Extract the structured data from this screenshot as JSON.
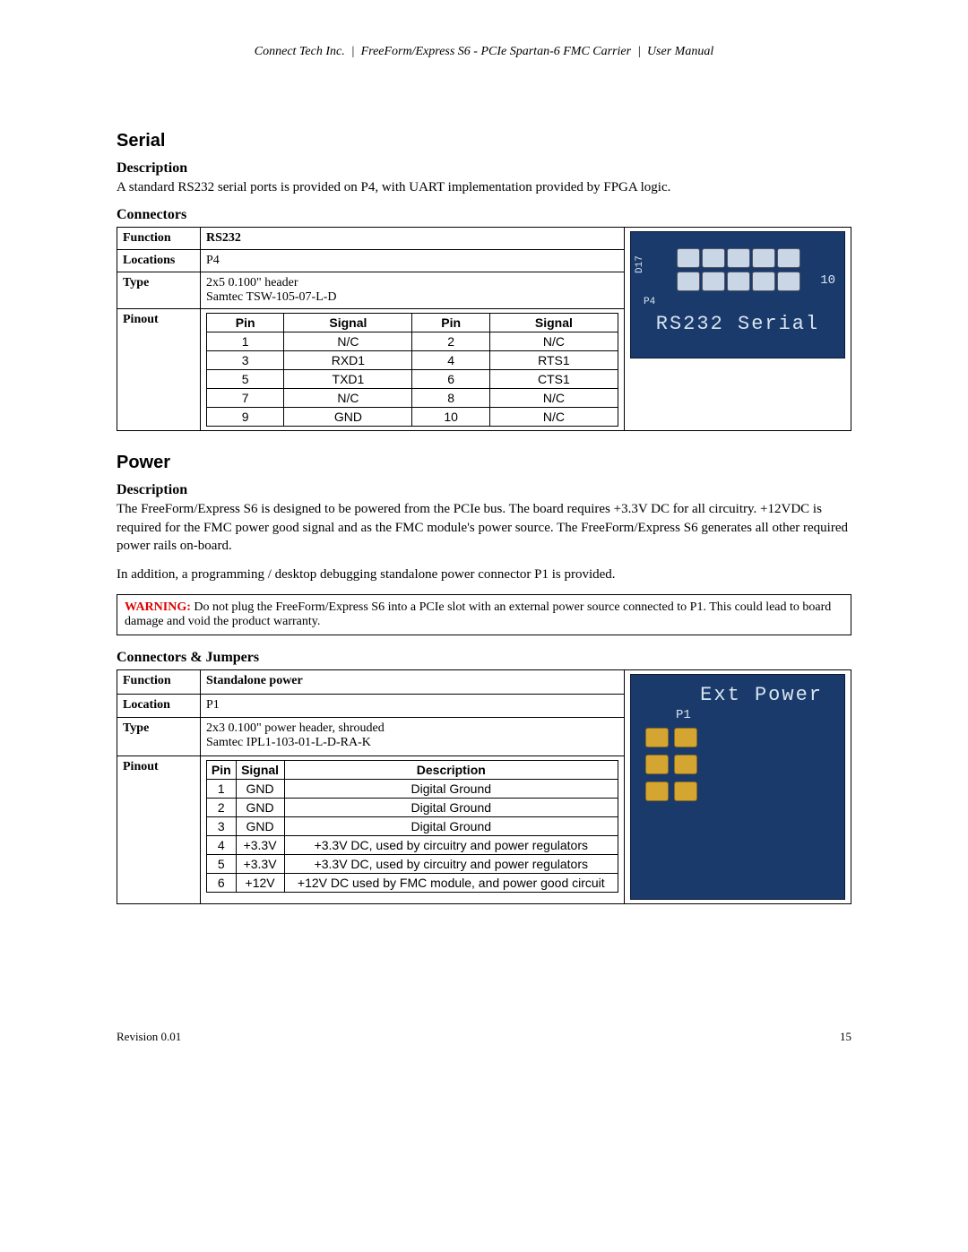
{
  "header": {
    "company": "Connect Tech Inc.",
    "product": "FreeForm/Express S6 - PCIe Spartan-6 FMC Carrier",
    "doc": "User Manual"
  },
  "serial": {
    "title": "Serial",
    "desc_h": "Description",
    "desc": "A standard RS232 serial ports is provided on P4, with UART implementation provided by FPGA logic.",
    "conn_h": "Connectors",
    "labels": {
      "function": "Function",
      "locations": "Locations",
      "type": "Type",
      "pinout": "Pinout"
    },
    "function": "RS232",
    "locations": "P4",
    "type": "2x5 0.100\" header\nSamtec TSW-105-07-L-D",
    "pinout_headers": [
      "Pin",
      "Signal",
      "Pin",
      "Signal"
    ],
    "pinout": [
      [
        "1",
        "N/C",
        "2",
        "N/C"
      ],
      [
        "3",
        "RXD1",
        "4",
        "RTS1"
      ],
      [
        "5",
        "TXD1",
        "6",
        "CTS1"
      ],
      [
        "7",
        "N/C",
        "8",
        "N/C"
      ],
      [
        "9",
        "GND",
        "10",
        "N/C"
      ]
    ],
    "silk": {
      "ref": "D17",
      "p4": "P4",
      "pin10": "10",
      "title": "RS232 Serial"
    }
  },
  "power": {
    "title": "Power",
    "desc_h": "Description",
    "desc1": "The FreeForm/Express S6 is designed to be powered from the PCIe bus.  The board requires +3.3V DC for all circuitry. +12VDC is required for the FMC power good signal and as the FMC module's power source. The FreeForm/Express S6 generates all other required power rails on-board.",
    "desc2": "In addition, a programming / desktop debugging standalone power connector P1 is provided.",
    "warn_label": "WARNING:",
    "warn": " Do not plug the FreeForm/Express S6 into a PCIe slot with an external power source connected to P1.  This could lead to board damage and void the product warranty.",
    "conn_h": "Connectors & Jumpers",
    "labels": {
      "function": "Function",
      "location": "Location",
      "type": "Type",
      "pinout": "Pinout"
    },
    "function": "Standalone power",
    "location": "P1",
    "type": "2x3 0.100\" power header, shrouded\nSamtec IPL1-103-01-L-D-RA-K",
    "pinout_headers": [
      "Pin",
      "Signal",
      "Description"
    ],
    "pinout": [
      [
        "1",
        "GND",
        "Digital Ground"
      ],
      [
        "2",
        "GND",
        "Digital Ground"
      ],
      [
        "3",
        "GND",
        "Digital Ground"
      ],
      [
        "4",
        "+3.3V",
        "+3.3V DC, used by circuitry and power regulators"
      ],
      [
        "5",
        "+3.3V",
        "+3.3V DC, used by circuitry and power regulators"
      ],
      [
        "6",
        "+12V",
        "+12V DC used by FMC module, and power good circuit"
      ]
    ],
    "silk": {
      "title": "Ext Power",
      "p1": "P1"
    }
  },
  "footer": {
    "rev": "Revision 0.01",
    "page": "15"
  }
}
